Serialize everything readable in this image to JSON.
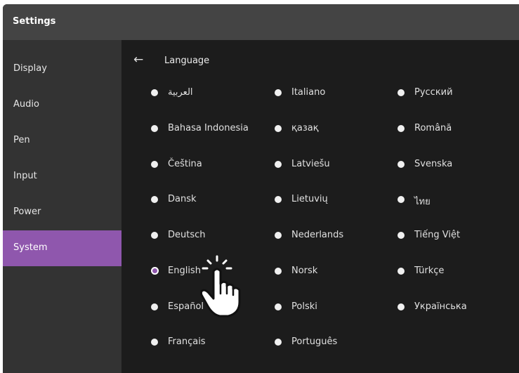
{
  "window": {
    "title": "Settings"
  },
  "sidebar": {
    "items": [
      {
        "label": "Display"
      },
      {
        "label": "Audio"
      },
      {
        "label": "Pen"
      },
      {
        "label": "Input"
      },
      {
        "label": "Power"
      },
      {
        "label": "System",
        "active": true
      }
    ]
  },
  "content": {
    "back_icon": "left-arrow-icon",
    "heading": "Language",
    "selected": "English",
    "columns": [
      [
        "العربية",
        "Bahasa Indonesia",
        "Čeština",
        "Dansk",
        "Deutsch",
        "English",
        "Español",
        "Français"
      ],
      [
        "Italiano",
        "қазақ",
        "Latviešu",
        "Lietuvių",
        "Nederlands",
        "Norsk",
        "Polski",
        "Português"
      ],
      [
        "Русский",
        "Română",
        "Svenska",
        "ไทย",
        "Tiếng Việt",
        "Türkçe",
        "Українська"
      ]
    ]
  },
  "cursor": {
    "icon": "pointing-hand-cursor-icon"
  },
  "colors": {
    "accent": "#8f57ad",
    "titlebar": "#444444",
    "sidebar": "#333333",
    "content_bg": "#1c1c1c"
  }
}
